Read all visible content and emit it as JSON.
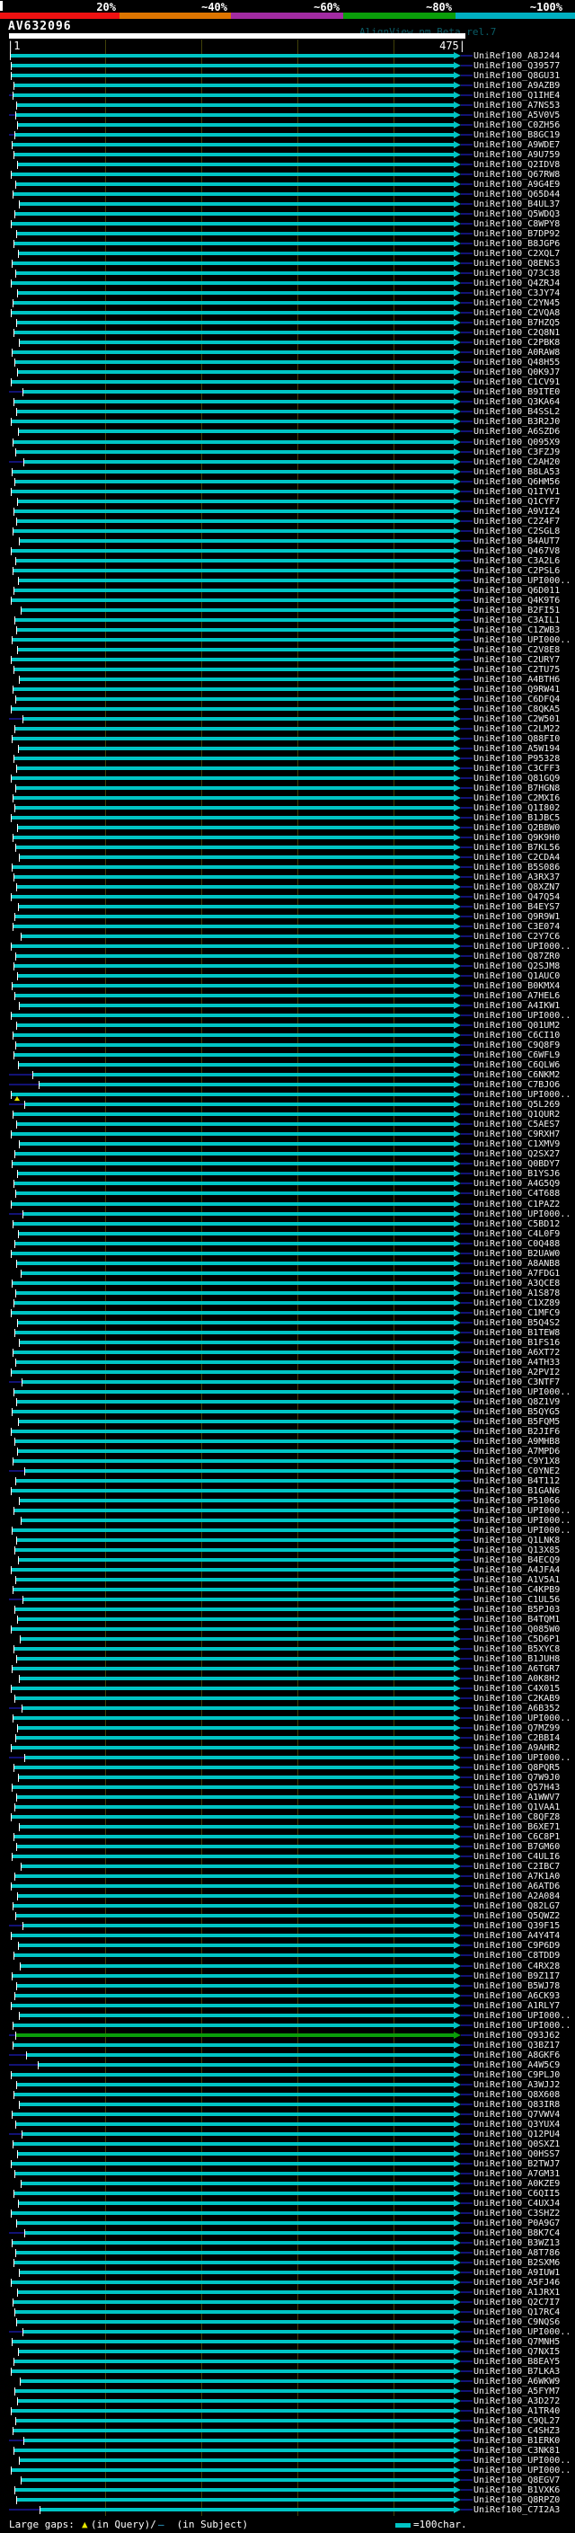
{
  "chart_data": {
    "type": "bar",
    "title": "AV632096",
    "watermark": "AlignView.pm Beta rel.7",
    "xlabel": "query position (characters)",
    "x_range": [
      1,
      475
    ],
    "ruler": {
      "start_label": "|1",
      "end_label": "475|",
      "tick_interval_chars": 100
    },
    "identity_scale": [
      {
        "label": "20%",
        "color": "#EE1111",
        "end": 133
      },
      {
        "label": "~40%",
        "color": "#DD7500",
        "end": 257
      },
      {
        "label": "~60%",
        "color": "#A22BA2",
        "end": 382
      },
      {
        "label": "~80%",
        "color": "#0A9E0A",
        "end": 507
      },
      {
        "label": "~100%",
        "color": "#00AFC0",
        "end": 630
      }
    ],
    "colors": {
      "hit_bar": "#00C4C4",
      "hit_bar_green": "#0A9E0A",
      "navy": "#121275",
      "grid": "#404008",
      "query_bar": "#FFFFFF",
      "gap_in_query_marker": "#E8E800",
      "gap_in_subject_marker": "#35B7E8"
    },
    "footer": {
      "prefix": "Large gaps: ",
      "query_marker": "▲",
      "mid": "(in Query)/",
      "subject_marker": "—",
      "suffix": " (in Subject)",
      "scale_icon_label": "=100char."
    },
    "hits": [
      [
        "UniRef100_A8J244",
        12
      ],
      [
        "UniRef100_Q39577",
        13
      ],
      [
        "UniRef100_Q8GU31",
        13
      ],
      [
        "UniRef100_A9AZB9",
        16
      ],
      [
        "UniRef100_Q1IHE4",
        15,
        {
          "l": 1
        }
      ],
      [
        "UniRef100_A7NS53",
        19
      ],
      [
        "UniRef100_A5V0V5",
        18,
        {
          "l": 1
        }
      ],
      [
        "UniRef100_C0ZH56",
        20
      ],
      [
        "UniRef100_B8GC19",
        17,
        {
          "l": 1
        }
      ],
      [
        "UniRef100_A9WDE7",
        14
      ],
      [
        "UniRef100_A9U759",
        16
      ],
      [
        "UniRef100_Q2IDV8",
        20
      ],
      [
        "UniRef100_Q67RW8",
        13
      ],
      [
        "UniRef100_A9G4E9",
        18
      ],
      [
        "UniRef100_Q65D44",
        15
      ],
      [
        "UniRef100_B4UL37",
        22
      ],
      [
        "UniRef100_Q5WDQ3",
        17
      ],
      [
        "UniRef100_C8WPY8",
        13
      ],
      [
        "UniRef100_B7DP92",
        19
      ],
      [
        "UniRef100_B8JGP6",
        16
      ],
      [
        "UniRef100_C2XQL7",
        21
      ],
      [
        "UniRef100_Q8ENS3",
        14
      ],
      [
        "UniRef100_Q73C38",
        18
      ],
      [
        "UniRef100_Q4ZRJ4",
        13
      ],
      [
        "UniRef100_C3JY74",
        20
      ],
      [
        "UniRef100_C2YN45",
        15
      ],
      [
        "UniRef100_C2VQA8",
        13
      ],
      [
        "UniRef100_B7HZQ5",
        19
      ],
      [
        "UniRef100_C2Q8N1",
        16
      ],
      [
        "UniRef100_C2PBK8",
        22
      ],
      [
        "UniRef100_A0RAW8",
        14
      ],
      [
        "UniRef100_Q48H55",
        17
      ],
      [
        "UniRef100_Q0K9J7",
        20
      ],
      [
        "UniRef100_C1CV91",
        13
      ],
      [
        "UniRef100_B9ITE0",
        26
      ],
      [
        "UniRef100_Q3KA64",
        16
      ],
      [
        "UniRef100_B4SSL2",
        19
      ],
      [
        "UniRef100_B3R2J0",
        13
      ],
      [
        "UniRef100_A6SZD6",
        21
      ],
      [
        "UniRef100_Q095X9",
        15
      ],
      [
        "UniRef100_C3FZJ9",
        18
      ],
      [
        "UniRef100_C2AH20",
        27
      ],
      [
        "UniRef100_B8LA53",
        14
      ],
      [
        "UniRef100_Q6HM56",
        17
      ],
      [
        "UniRef100_Q1IYV1",
        13
      ],
      [
        "UniRef100_Q1CYF7",
        20
      ],
      [
        "UniRef100_A9VIZ4",
        16
      ],
      [
        "UniRef100_C2Z4F7",
        19
      ],
      [
        "UniRef100_C2SGL8",
        15
      ],
      [
        "UniRef100_B4AUT7",
        22
      ],
      [
        "UniRef100_Q467V8",
        13
      ],
      [
        "UniRef100_C3A2L6",
        18
      ],
      [
        "UniRef100_C2PSL6",
        15
      ],
      [
        "UniRef100_UPI000..",
        21
      ],
      [
        "UniRef100_Q6D011",
        16
      ],
      [
        "UniRef100_Q4K9T6",
        13
      ],
      [
        "UniRef100_B2FI51",
        24
      ],
      [
        "UniRef100_C3AIL1",
        17
      ],
      [
        "UniRef100_C1ZWB3",
        19
      ],
      [
        "UniRef100_UPI000..",
        14
      ],
      [
        "UniRef100_C2V8E8",
        20
      ],
      [
        "UniRef100_C2URY7",
        13
      ],
      [
        "UniRef100_C2TU75",
        16
      ],
      [
        "UniRef100_A4BTH6",
        22
      ],
      [
        "UniRef100_Q9RW41",
        15
      ],
      [
        "UniRef100_C6DFQ4",
        18
      ],
      [
        "UniRef100_C8QKA5",
        13
      ],
      [
        "UniRef100_C2W501",
        26
      ],
      [
        "UniRef100_C2LM22",
        17
      ],
      [
        "UniRef100_Q88FI0",
        14
      ],
      [
        "UniRef100_A5W194",
        21
      ],
      [
        "UniRef100_P95328",
        16
      ],
      [
        "UniRef100_C3CFF3",
        19
      ],
      [
        "UniRef100_Q81GQ9",
        13
      ],
      [
        "UniRef100_B7HGN8",
        18
      ],
      [
        "UniRef100_C2MXI6",
        15
      ],
      [
        "UniRef100_Q1I802",
        17
      ],
      [
        "UniRef100_B1JBC5",
        13
      ],
      [
        "UniRef100_Q2BBW0",
        20
      ],
      [
        "UniRef100_Q9K9H0",
        15
      ],
      [
        "UniRef100_B7KL56",
        18
      ],
      [
        "UniRef100_C2CDA4",
        22
      ],
      [
        "UniRef100_B5S086",
        14
      ],
      [
        "UniRef100_A3RX37",
        16
      ],
      [
        "UniRef100_Q8XZN7",
        19
      ],
      [
        "UniRef100_Q47Q54",
        13
      ],
      [
        "UniRef100_B4EYS7",
        21
      ],
      [
        "UniRef100_Q9R9W1",
        17
      ],
      [
        "UniRef100_C3E074",
        15
      ],
      [
        "UniRef100_C2Y7C6",
        24
      ],
      [
        "UniRef100_UPI000..",
        13
      ],
      [
        "UniRef100_Q87ZR0",
        18
      ],
      [
        "UniRef100_Q2SJM8",
        16
      ],
      [
        "UniRef100_Q1AUC0",
        20
      ],
      [
        "UniRef100_B0KMX4",
        14
      ],
      [
        "UniRef100_A7HEL6",
        17
      ],
      [
        "UniRef100_A4IKW1",
        22
      ],
      [
        "UniRef100_UPI000..",
        13
      ],
      [
        "UniRef100_Q01UM2",
        19
      ],
      [
        "UniRef100_C6CI10",
        15
      ],
      [
        "UniRef100_C9Q8F9",
        18
      ],
      [
        "UniRef100_C6WFL9",
        16
      ],
      [
        "UniRef100_C6QLW6",
        21
      ],
      [
        "UniRef100_C6NKM2",
        37
      ],
      [
        "UniRef100_C7BJO6",
        44
      ],
      [
        "UniRef100_UPI000..",
        13,
        {
          "g": 19
        }
      ],
      [
        "UniRef100_Q5L269",
        28
      ],
      [
        "UniRef100_Q1QUR2",
        15
      ],
      [
        "UniRef100_C5AES7",
        19
      ],
      [
        "UniRef100_C9RXH7",
        13
      ],
      [
        "UniRef100_C1XMV9",
        22
      ],
      [
        "UniRef100_Q2SX27",
        17
      ],
      [
        "UniRef100_Q0BDY7",
        14
      ],
      [
        "UniRef100_B1YSJ6",
        20
      ],
      [
        "UniRef100_A4G5Q9",
        16
      ],
      [
        "UniRef100_C4T688",
        18
      ],
      [
        "UniRef100_C1PAZ2",
        13
      ],
      [
        "UniRef100_UPI000..",
        26
      ],
      [
        "UniRef100_C5BD12",
        15
      ],
      [
        "UniRef100_C4L0F9",
        21
      ],
      [
        "UniRef100_C0Q488",
        17
      ],
      [
        "UniRef100_B2UAW0",
        13
      ],
      [
        "UniRef100_A8ANB8",
        19
      ],
      [
        "UniRef100_A7FDG1",
        24
      ],
      [
        "UniRef100_A3QCE8",
        14
      ],
      [
        "UniRef100_A1S878",
        18
      ],
      [
        "UniRef100_C1XZ89",
        16
      ],
      [
        "UniRef100_C1MFC9",
        13
      ],
      [
        "UniRef100_B5Q4S2",
        20
      ],
      [
        "UniRef100_B1TEW8",
        17
      ],
      [
        "UniRef100_B1FS16",
        22
      ],
      [
        "UniRef100_A6XT72",
        15
      ],
      [
        "UniRef100_A4TH33",
        18
      ],
      [
        "UniRef100_A2PVI2",
        13
      ],
      [
        "UniRef100_C3NTF7",
        25
      ],
      [
        "UniRef100_UPI000..",
        16
      ],
      [
        "UniRef100_Q8Z1V9",
        19
      ],
      [
        "UniRef100_B5QYG5",
        14
      ],
      [
        "UniRef100_B5FQM5",
        21
      ],
      [
        "UniRef100_B2JIF6",
        13
      ],
      [
        "UniRef100_A9MHB8",
        17
      ],
      [
        "UniRef100_A7MPD6",
        20
      ],
      [
        "UniRef100_C9Y1X8",
        15
      ],
      [
        "UniRef100_C0YNE2",
        28
      ],
      [
        "UniRef100_B4T112",
        18
      ],
      [
        "UniRef100_B1GAN6",
        13
      ],
      [
        "UniRef100_P51066",
        22
      ],
      [
        "UniRef100_UPI000..",
        16
      ],
      [
        "UniRef100_UPI000..",
        24
      ],
      [
        "UniRef100_UPI000..",
        14
      ],
      [
        "UniRef100_Q1LNK8",
        19
      ],
      [
        "UniRef100_Q13X85",
        17
      ],
      [
        "UniRef100_B4ECQ9",
        21
      ],
      [
        "UniRef100_A4JFA4",
        13
      ],
      [
        "UniRef100_A1V5A1",
        18
      ],
      [
        "UniRef100_C4KPB9",
        15
      ],
      [
        "UniRef100_C1UL56",
        26
      ],
      [
        "UniRef100_B5PJ03",
        17
      ],
      [
        "UniRef100_B4TQM1",
        20
      ],
      [
        "UniRef100_Q085W0",
        13
      ],
      [
        "UniRef100_C5D6P1",
        23
      ],
      [
        "UniRef100_B5XYC8",
        16
      ],
      [
        "UniRef100_B1JUH8",
        19
      ],
      [
        "UniRef100_A6TGR7",
        14
      ],
      [
        "UniRef100_A0K8H2",
        22
      ],
      [
        "UniRef100_C4X015",
        13
      ],
      [
        "UniRef100_C2KAB9",
        17
      ],
      [
        "UniRef100_A6B352",
        25
      ],
      [
        "UniRef100_UPI000..",
        15
      ],
      [
        "UniRef100_Q7MZ99",
        20
      ],
      [
        "UniRef100_C2BBI4",
        18
      ],
      [
        "UniRef100_A9AHR2",
        13
      ],
      [
        "UniRef100_UPI000..",
        28
      ],
      [
        "UniRef100_Q8PQR5",
        16
      ],
      [
        "UniRef100_Q7W9J0",
        21
      ],
      [
        "UniRef100_Q57H43",
        14
      ],
      [
        "UniRef100_A1WWV7",
        19
      ],
      [
        "UniRef100_Q1VAA1",
        17
      ],
      [
        "UniRef100_C8QFZ8",
        13
      ],
      [
        "UniRef100_B6XE71",
        22
      ],
      [
        "UniRef100_C6C8P1",
        16
      ],
      [
        "UniRef100_B7GM60",
        19
      ],
      [
        "UniRef100_C4ULI6",
        14
      ],
      [
        "UniRef100_C2IBC7",
        24
      ],
      [
        "UniRef100_A7K1A0",
        17
      ],
      [
        "UniRef100_A6ATD6",
        13
      ],
      [
        "UniRef100_A2A084",
        20
      ],
      [
        "UniRef100_Q82LG7",
        15
      ],
      [
        "UniRef100_Q5QWZ2",
        18
      ],
      [
        "UniRef100_Q39F15",
        26
      ],
      [
        "UniRef100_A4Y4T4",
        13
      ],
      [
        "UniRef100_C9P6D9",
        21
      ],
      [
        "UniRef100_C8TDD9",
        16
      ],
      [
        "UniRef100_C4RX28",
        23
      ],
      [
        "UniRef100_B9Z1I7",
        14
      ],
      [
        "UniRef100_B5WJ78",
        19
      ],
      [
        "UniRef100_A6CK93",
        17
      ],
      [
        "UniRef100_A1RLY7",
        13
      ],
      [
        "UniRef100_UPI000..",
        22
      ],
      [
        "UniRef100_UPI000..",
        15
      ],
      [
        "UniRef100_Q93J62",
        18,
        {
          "c": 1,
          "l": 1
        }
      ],
      [
        "UniRef100_Q3BZ17",
        15
      ],
      [
        "UniRef100_A8GKF6",
        30
      ],
      [
        "UniRef100_A4W5C9",
        43
      ],
      [
        "UniRef100_C9PLJ0",
        13
      ],
      [
        "UniRef100_A3WJJ2",
        19
      ],
      [
        "UniRef100_Q8X608",
        16
      ],
      [
        "UniRef100_Q83IR8",
        22
      ],
      [
        "UniRef100_Q7VWV4",
        14
      ],
      [
        "UniRef100_Q3YUX4",
        18
      ],
      [
        "UniRef100_Q12PU4",
        25
      ],
      [
        "UniRef100_Q0SXZ1",
        15
      ],
      [
        "UniRef100_Q0HSS7",
        20
      ],
      [
        "UniRef100_B2TWJ7",
        13
      ],
      [
        "UniRef100_A7GM31",
        17
      ],
      [
        "UniRef100_A0KZE9",
        24
      ],
      [
        "UniRef100_C6QII5",
        16
      ],
      [
        "UniRef100_C4UXJ4",
        21
      ],
      [
        "UniRef100_C3SHZ2",
        13
      ],
      [
        "UniRef100_P0A9G7",
        19
      ],
      [
        "UniRef100_B8K7C4",
        28
      ],
      [
        "UniRef100_B3WZ13",
        14
      ],
      [
        "UniRef100_A8T786",
        18
      ],
      [
        "UniRef100_B2SXM6",
        16
      ],
      [
        "UniRef100_A9IUW1",
        22
      ],
      [
        "UniRef100_A5FJ46",
        13
      ],
      [
        "UniRef100_A1JRX1",
        20
      ],
      [
        "UniRef100_Q2C7I7",
        15
      ],
      [
        "UniRef100_Q17RC4",
        17
      ],
      [
        "UniRef100_C9NQS6",
        19
      ],
      [
        "UniRef100_UPI000..",
        26
      ],
      [
        "UniRef100_Q7MNH5",
        14
      ],
      [
        "UniRef100_Q7NXI5",
        21
      ],
      [
        "UniRef100_B8EAY5",
        16
      ],
      [
        "UniRef100_B7LKA3",
        13
      ],
      [
        "UniRef100_A6WKW9",
        23
      ],
      [
        "UniRef100_A5FYM7",
        17
      ],
      [
        "UniRef100_A3D272",
        20
      ],
      [
        "UniRef100_A1TR40",
        13
      ],
      [
        "UniRef100_C9QL27",
        18
      ],
      [
        "UniRef100_C4SHZ3",
        15
      ],
      [
        "UniRef100_B1ERK0",
        27
      ],
      [
        "UniRef100_C3NK81",
        16
      ],
      [
        "UniRef100_UPI000..",
        22
      ],
      [
        "UniRef100_UPI000..",
        13
      ],
      [
        "UniRef100_Q8EGV7",
        24
      ],
      [
        "UniRef100_B1VXK6",
        17
      ],
      [
        "UniRef100_Q8RPZ0",
        19
      ],
      [
        "UniRef100_C7I2A3",
        45
      ]
    ]
  }
}
